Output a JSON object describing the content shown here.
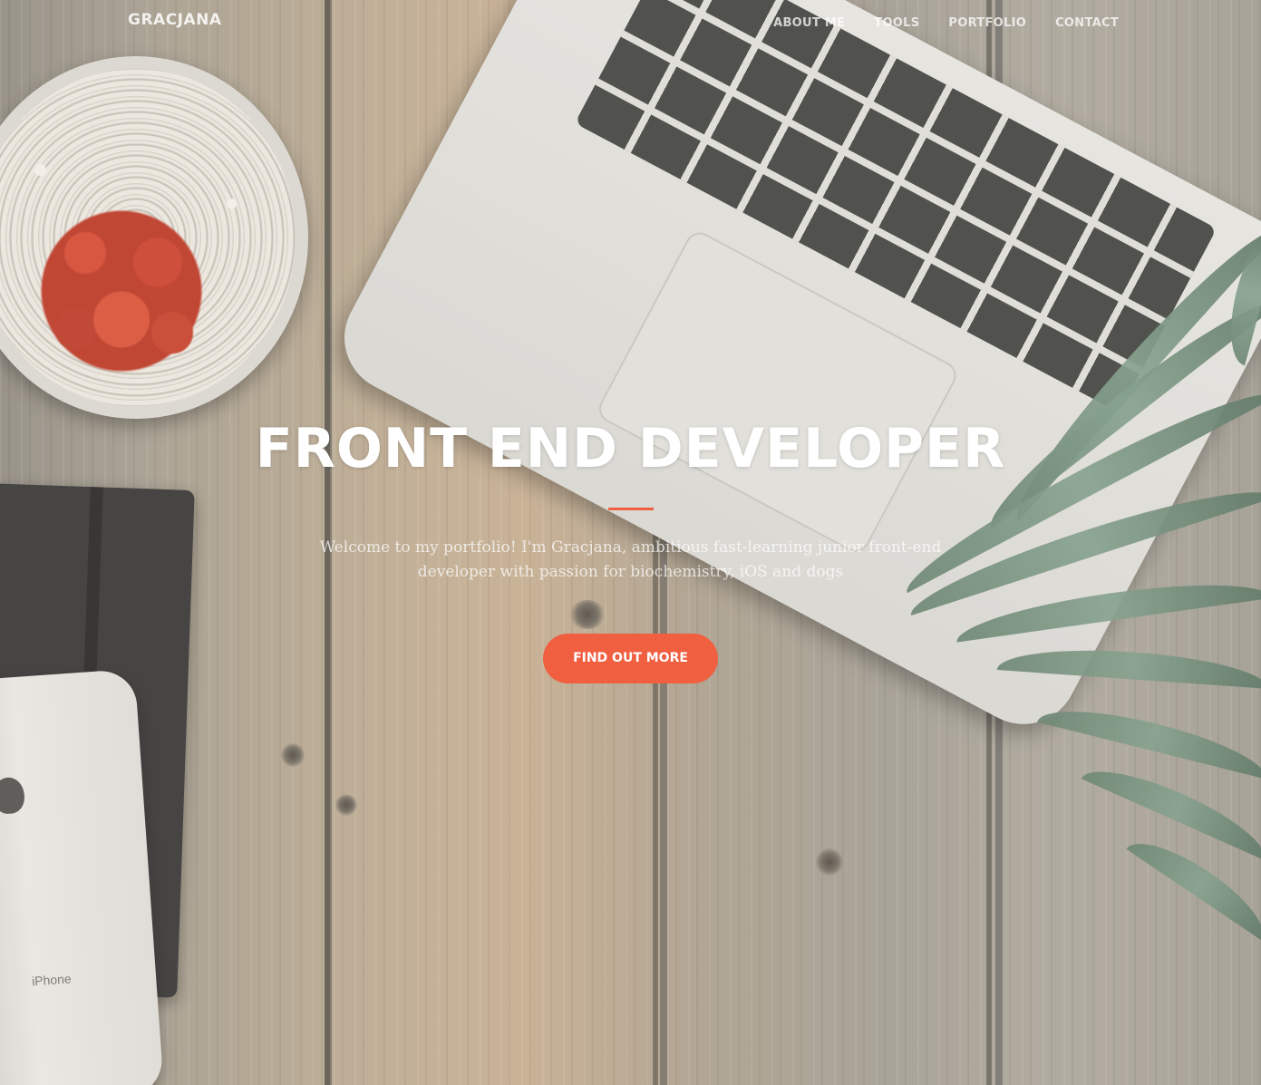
{
  "navbar": {
    "brand": "Gracjana",
    "links": [
      {
        "label": "About Me"
      },
      {
        "label": "Tools"
      },
      {
        "label": "Portfolio"
      },
      {
        "label": "Contact"
      }
    ]
  },
  "hero": {
    "title": "Front End Developer",
    "subtitle": "Welcome to my portfolio! I'm Gracjana, ambitious fast-learning junior front-end developer with passion for biochemistry, iOS and dogs",
    "cta_label": "Find Out More",
    "background_image": "laptop-cactus-phone-pineapple-on-wood"
  },
  "decor": {
    "phone_label": "iPhone"
  },
  "colors": {
    "accent": "#f05f40",
    "text": "#ffffff"
  }
}
